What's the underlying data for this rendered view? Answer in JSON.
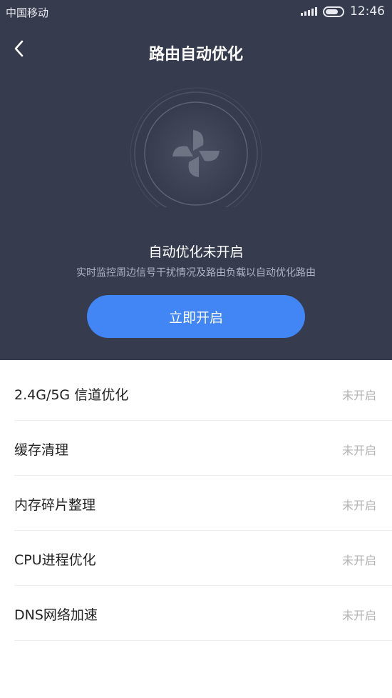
{
  "status_bar": {
    "carrier": "中国移动",
    "time": "12:46"
  },
  "header": {
    "title": "路由自动优化",
    "back_icon": "chevron-left-icon"
  },
  "hero": {
    "fan_icon": "fan-icon",
    "state_text": "自动优化未开启",
    "description": "实时监控周边信号干扰情况及路由负载以自动优化路由",
    "button_label": "立即开启",
    "accent_color": "#4285f4",
    "background_color": "#363b4d"
  },
  "items": [
    {
      "label": "2.4G/5G 信道优化",
      "status": "未开启"
    },
    {
      "label": "缓存清理",
      "status": "未开启"
    },
    {
      "label": "内存碎片整理",
      "status": "未开启"
    },
    {
      "label": "CPU进程优化",
      "status": "未开启"
    },
    {
      "label": "DNS网络加速",
      "status": "未开启"
    }
  ]
}
